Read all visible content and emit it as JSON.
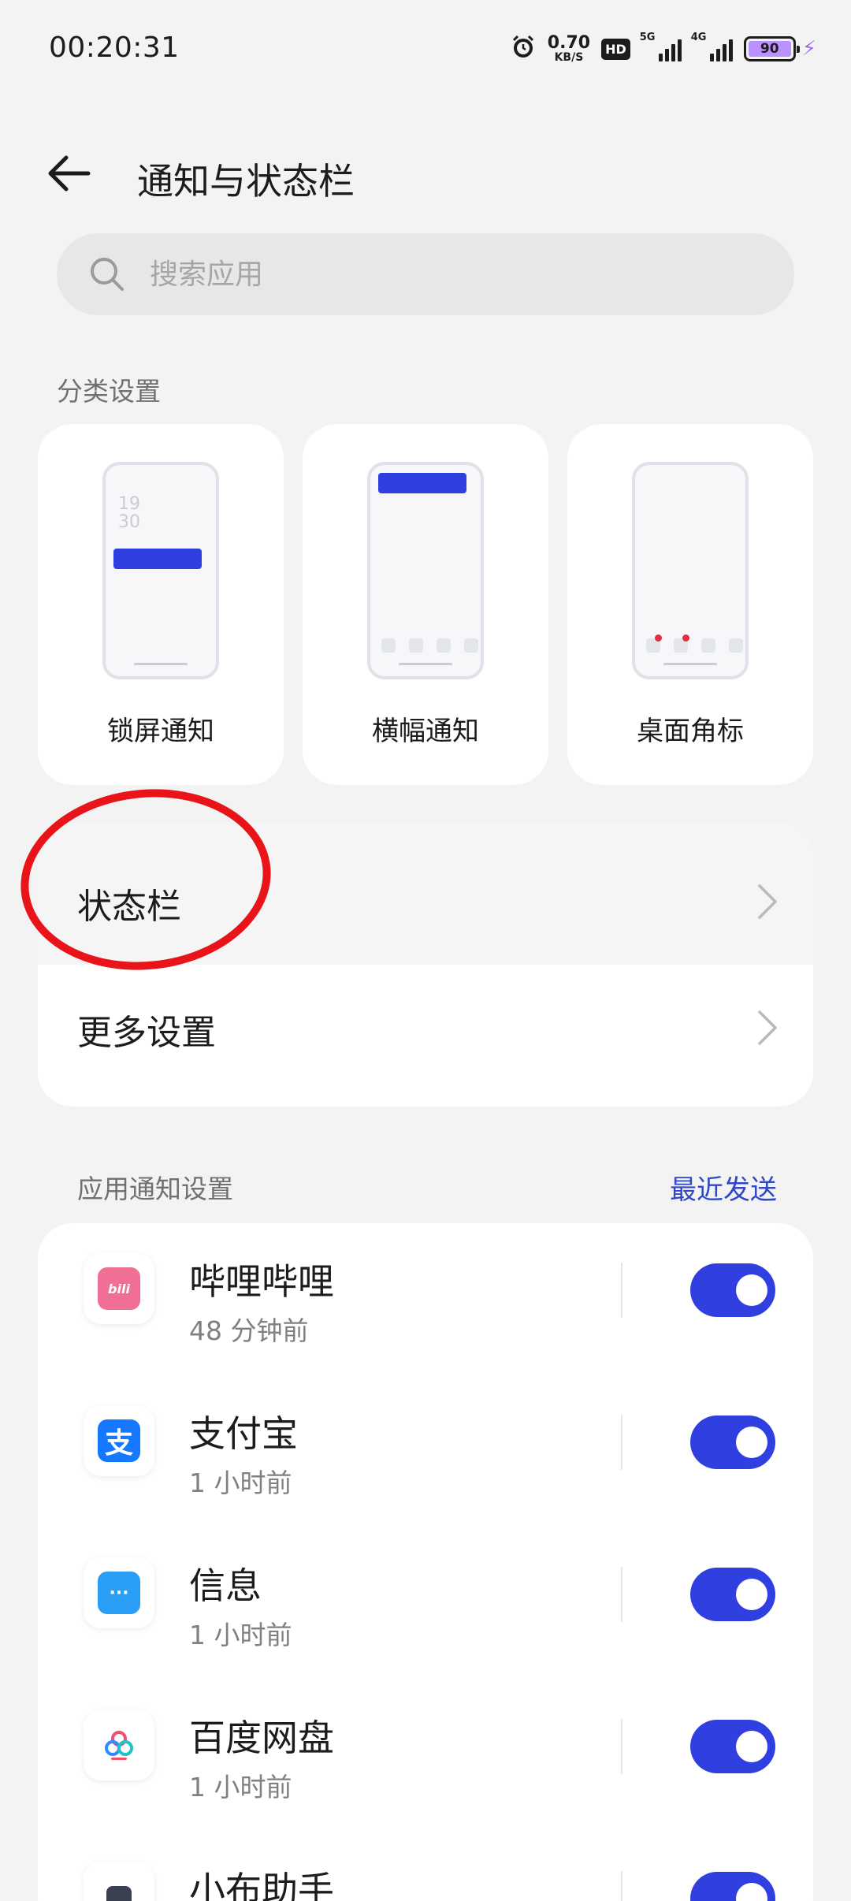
{
  "status_bar": {
    "time": "00:20:31",
    "net_speed_value": "0.70",
    "net_speed_unit": "KB/S",
    "hd_label": "HD",
    "sim1_label": "5G",
    "sim2_label": "4G",
    "battery_level": "90",
    "icons": [
      "alarm-icon",
      "hd-icon",
      "signal-icon",
      "signal-icon",
      "battery-icon",
      "charging-icon"
    ]
  },
  "header": {
    "title": "通知与状态栏",
    "back_icon": "back-arrow-icon"
  },
  "search": {
    "placeholder": "搜索应用",
    "icon": "search-icon"
  },
  "category_section": {
    "label": "分类设置",
    "cards": [
      {
        "label": "锁屏通知",
        "clock_hour": "19",
        "clock_minute": "30"
      },
      {
        "label": "横幅通知"
      },
      {
        "label": "桌面角标"
      }
    ]
  },
  "settings_items": [
    {
      "label": "状态栏"
    },
    {
      "label": "更多设置"
    }
  ],
  "app_section": {
    "label": "应用通知设置",
    "recent_link": "最近发送",
    "apps": [
      {
        "name": "哔哩哔哩",
        "time": "48 分钟前",
        "icon": "bilibili-icon",
        "icon_glyph": "bili",
        "enabled": true,
        "color": "#f06f95"
      },
      {
        "name": "支付宝",
        "time": "1 小时前",
        "icon": "alipay-icon",
        "icon_glyph": "支",
        "enabled": true,
        "color": "#1677ff"
      },
      {
        "name": "信息",
        "time": "1 小时前",
        "icon": "messages-icon",
        "icon_glyph": "···",
        "enabled": true,
        "color": "#2a9df4"
      },
      {
        "name": "百度网盘",
        "time": "1 小时前",
        "icon": "baidu-netdisk-icon",
        "icon_glyph": "",
        "enabled": true,
        "color": "#ffffff"
      },
      {
        "name": "小布助手",
        "time": "",
        "icon": "assistant-icon",
        "icon_glyph": "",
        "enabled": true,
        "color": "#ffffff"
      }
    ]
  },
  "colors": {
    "accent": "#2f3fe0",
    "link": "#2f47c8",
    "background": "#f3f3f3",
    "annotation": "#e8141a"
  }
}
